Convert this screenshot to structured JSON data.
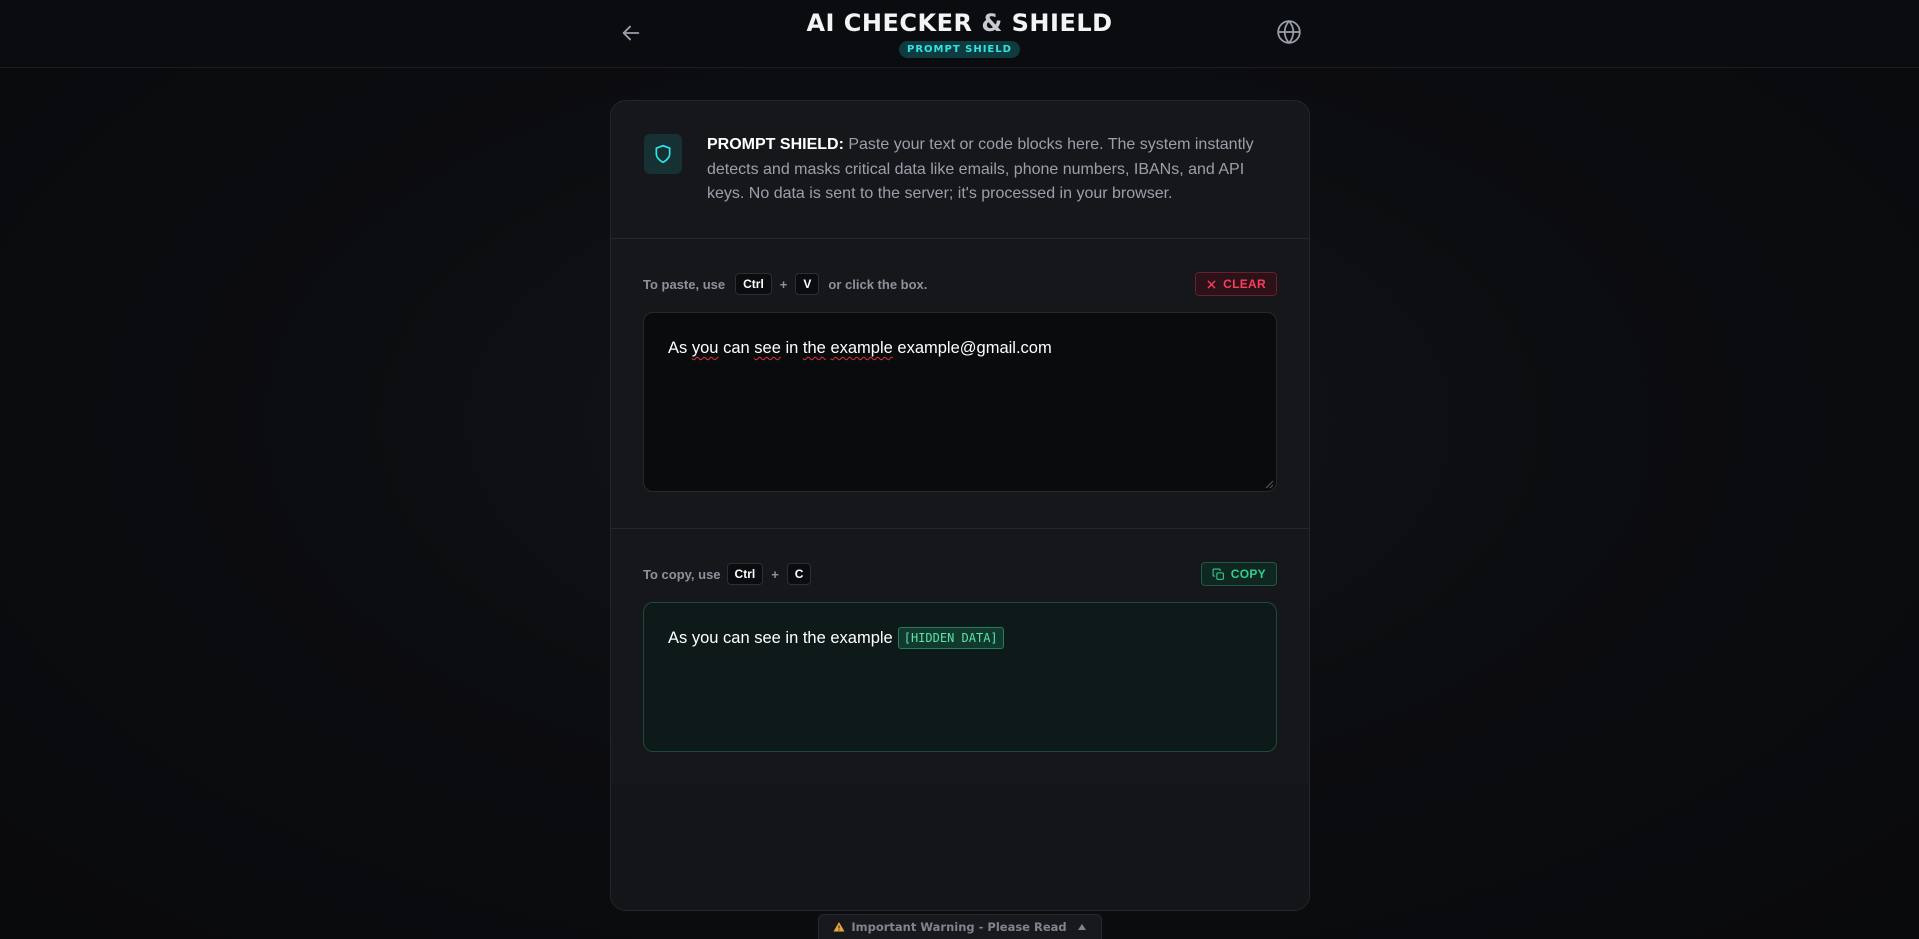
{
  "header": {
    "title_main": "AI CHECKER ",
    "title_amp": "&",
    "title_end": " SHIELD",
    "badge": "PROMPT SHIELD",
    "back_icon": "arrow-left-icon",
    "globe_icon": "globe-icon"
  },
  "info": {
    "label": "PROMPT SHIELD:",
    "text": " Paste your text or code blocks here. The system instantly detects and masks critical data like emails, phone numbers, IBANs, and API keys. No data is sent to the server; it's processed in your browser.",
    "icon": "shield-icon"
  },
  "paste": {
    "hint_prefix": "To paste, use",
    "key1": "Ctrl",
    "plus": "+",
    "key2": "V",
    "hint_suffix": "or click the box.",
    "clear_label": "CLEAR",
    "input_words": [
      "As",
      "you",
      "can",
      "see",
      "in",
      "the",
      "example",
      "example@gmail.com"
    ]
  },
  "copy": {
    "hint_prefix": "To copy, use",
    "key1": "Ctrl",
    "plus": "+",
    "key2": "C",
    "copy_label": "COPY",
    "output_text": "As you can see in the example",
    "hidden_tag": "[HIDDEN DATA]"
  },
  "warning": {
    "text": "Important Warning - Please Read"
  },
  "colors": {
    "accent_cyan": "#2ee6e6",
    "clear_red": "#ff3a5a",
    "copy_green": "#2fd08f"
  }
}
